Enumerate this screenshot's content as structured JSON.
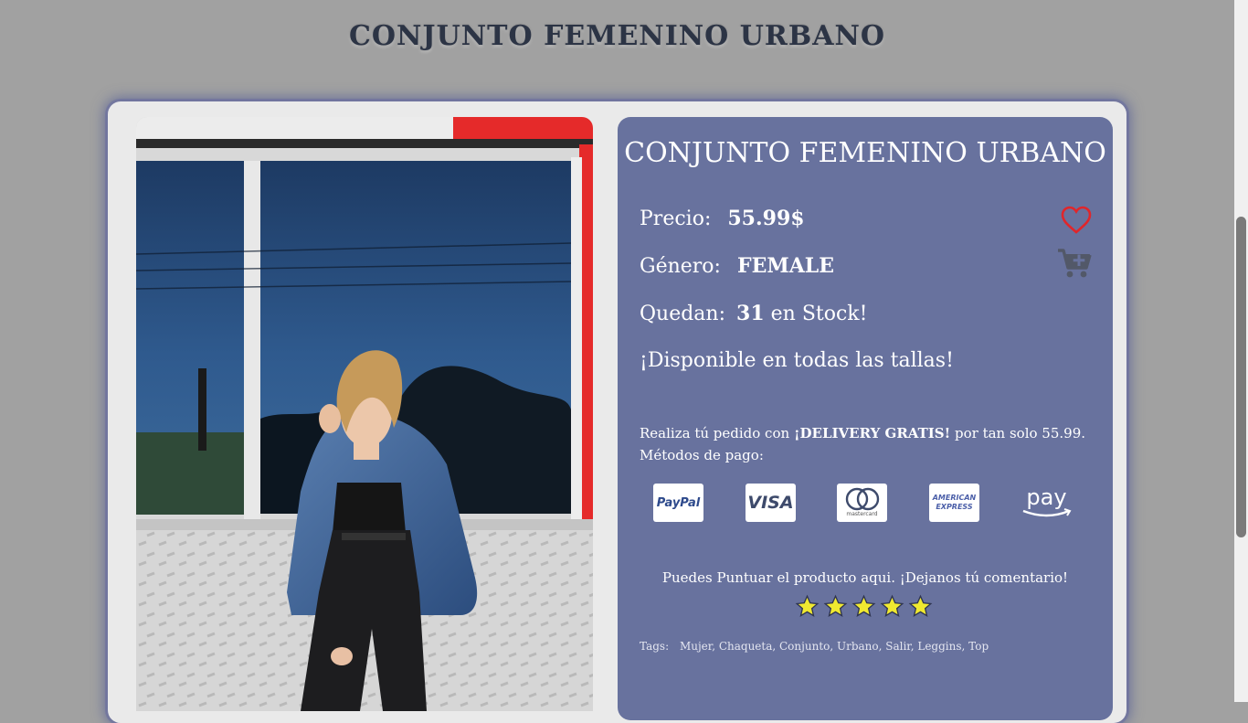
{
  "page": {
    "title": "CONJUNTO FEMENINO URBANO"
  },
  "product": {
    "title": "CONJUNTO FEMENINO URBANO",
    "price_label": "Precio:",
    "price_value": "55.99$",
    "gender_label": "Género:",
    "gender_value": "FEMALE",
    "stock_label": "Quedan:",
    "stock_value": "31",
    "stock_suffix": "en Stock!",
    "availability": "¡Disponible en todas las tallas!",
    "image_alt": "Mujer con chaqueta de jean y top negro frente a una ventana"
  },
  "actions": {
    "favorite_icon": "heart-outline-icon",
    "cart_icon": "cart-plus-icon",
    "favorite_color": "#e0262b",
    "cart_color": "#525868"
  },
  "delivery": {
    "prefix": "Realiza tú pedido con",
    "highlight": "¡DELIVERY GRATIS!",
    "suffix": "por tan solo 55.99.",
    "payment_label": "Métodos de pago:"
  },
  "payment_methods": [
    {
      "name": "PayPal",
      "label": "PayPal",
      "icon": "paypal-icon"
    },
    {
      "name": "Visa",
      "label": "VISA",
      "icon": "visa-icon"
    },
    {
      "name": "Mastercard",
      "label": "mastercard",
      "icon": "mastercard-icon"
    },
    {
      "name": "American Express",
      "label_line1": "AMERICAN",
      "label_line2": "EXPRESS",
      "icon": "amex-icon"
    },
    {
      "name": "Amazon Pay",
      "label": "pay",
      "icon": "amazon-pay-icon"
    }
  ],
  "rating": {
    "prompt": "Puedes Puntuar el producto aqui. ¡Dejanos tú comentario!",
    "max_stars": 5,
    "star_color": "#f0e930"
  },
  "tags": {
    "label": "Tags:",
    "items": "Mujer, Chaqueta, Conjunto, Urbano, Salir, Leggins, Top"
  },
  "colors": {
    "background": "#a1a1a1",
    "panel": "#68729e",
    "card": "#eaeaea",
    "title_text": "#2c3445"
  }
}
